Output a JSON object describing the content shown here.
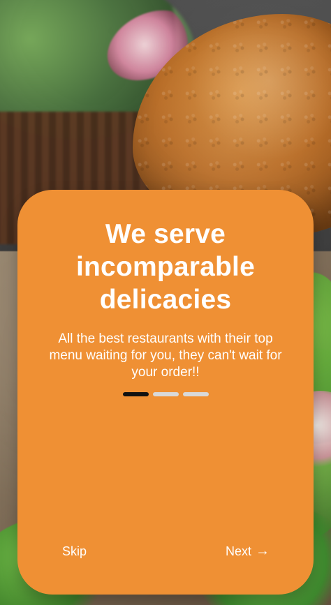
{
  "colors": {
    "card": "#ef9034",
    "text": "#ffffff",
    "indicator_active": "#111111",
    "indicator_inactive": "#d9d9d9"
  },
  "onboarding": {
    "title": "We serve incomparable delicacies",
    "subtitle": "All the best restaurants with their top menu waiting for you, they can't wait for your order!!",
    "pagination": {
      "active_index": 0,
      "count": 3
    },
    "actions": {
      "skip_label": "Skip",
      "next_label": "Next",
      "next_icon": "arrow-right-icon",
      "next_icon_glyph": "→"
    }
  }
}
